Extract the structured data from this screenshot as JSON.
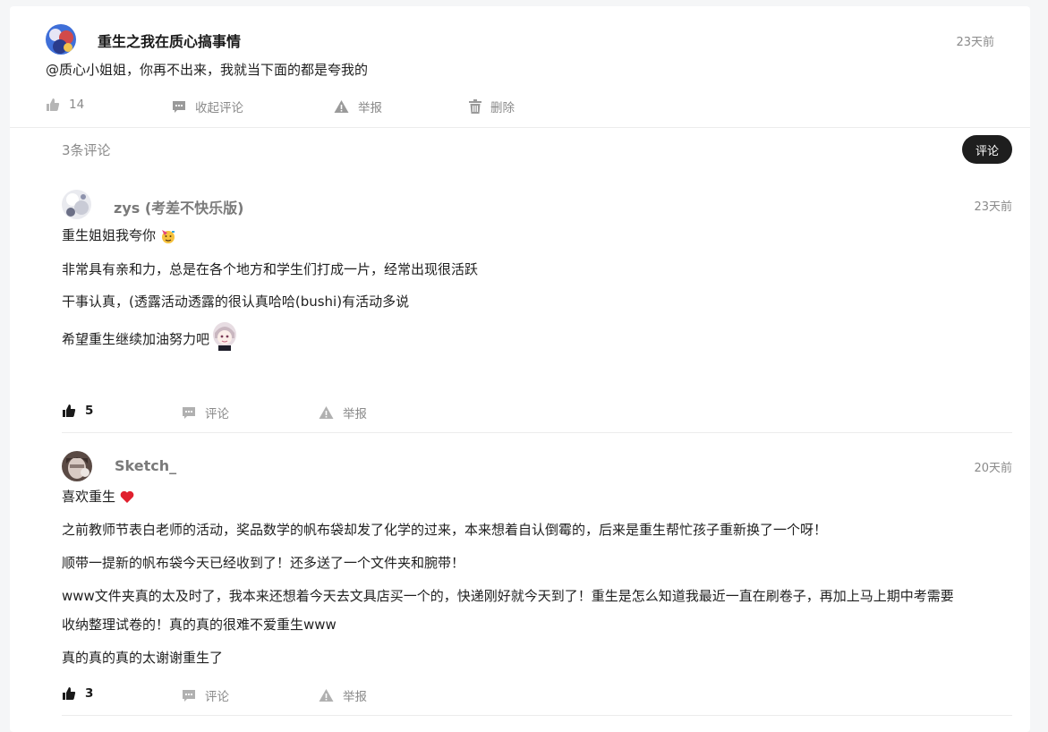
{
  "post": {
    "author": "重生之我在质心搞事情",
    "time": "23天前",
    "content": "@质心小姐姐，你再不出来，我就当下面的都是夸我的",
    "actions": {
      "likes": "14",
      "collapse": "收起评论",
      "report": "举报",
      "delete": "删除"
    }
  },
  "comments_header": {
    "count_label": "3条评论",
    "comment_button": "评论"
  },
  "comments": [
    {
      "author": "zys (考差不快乐版)",
      "time": "23天前",
      "lines": [
        "重生姐姐我夸你",
        "非常具有亲和力，总是在各个地方和学生们打成一片，经常出现很活跃",
        "干事认真，(透露活动透露的很认真哈哈(bushi)有活动多说",
        "希望重生继续加油努力吧"
      ],
      "likes": "5",
      "comment_label": "评论",
      "report_label": "举报"
    },
    {
      "author": "Sketch_",
      "time": "20天前",
      "lines": [
        "喜欢重生",
        "之前教师节表白老师的活动，奖品数学的帆布袋却发了化学的过来，本来想着自认倒霉的，后来是重生帮忙孩子重新换了一个呀！",
        "顺带一提新的帆布袋今天已经收到了！还多送了一个文件夹和腕带！",
        "www文件夹真的太及时了，我本来还想着今天去文具店买一个的，快递刚好就今天到了！重生是怎么知道我最近一直在刷卷子，再加上马上期中考需要",
        "收纳整理试卷的！真的真的很难不爱重生www",
        "真的真的真的太谢谢重生了"
      ],
      "likes": "3",
      "comment_label": "评论",
      "report_label": "举报"
    }
  ],
  "colors": {
    "accent_dark": "#1e1e1e",
    "muted_text": "#8a8a8a",
    "heart": "#e0202e"
  },
  "icons": [
    "thumb-up-icon",
    "comment-bubble-icon",
    "warning-triangle-icon",
    "trash-icon",
    "party-face-emoji",
    "anime-sticker",
    "red-heart-emoji"
  ]
}
